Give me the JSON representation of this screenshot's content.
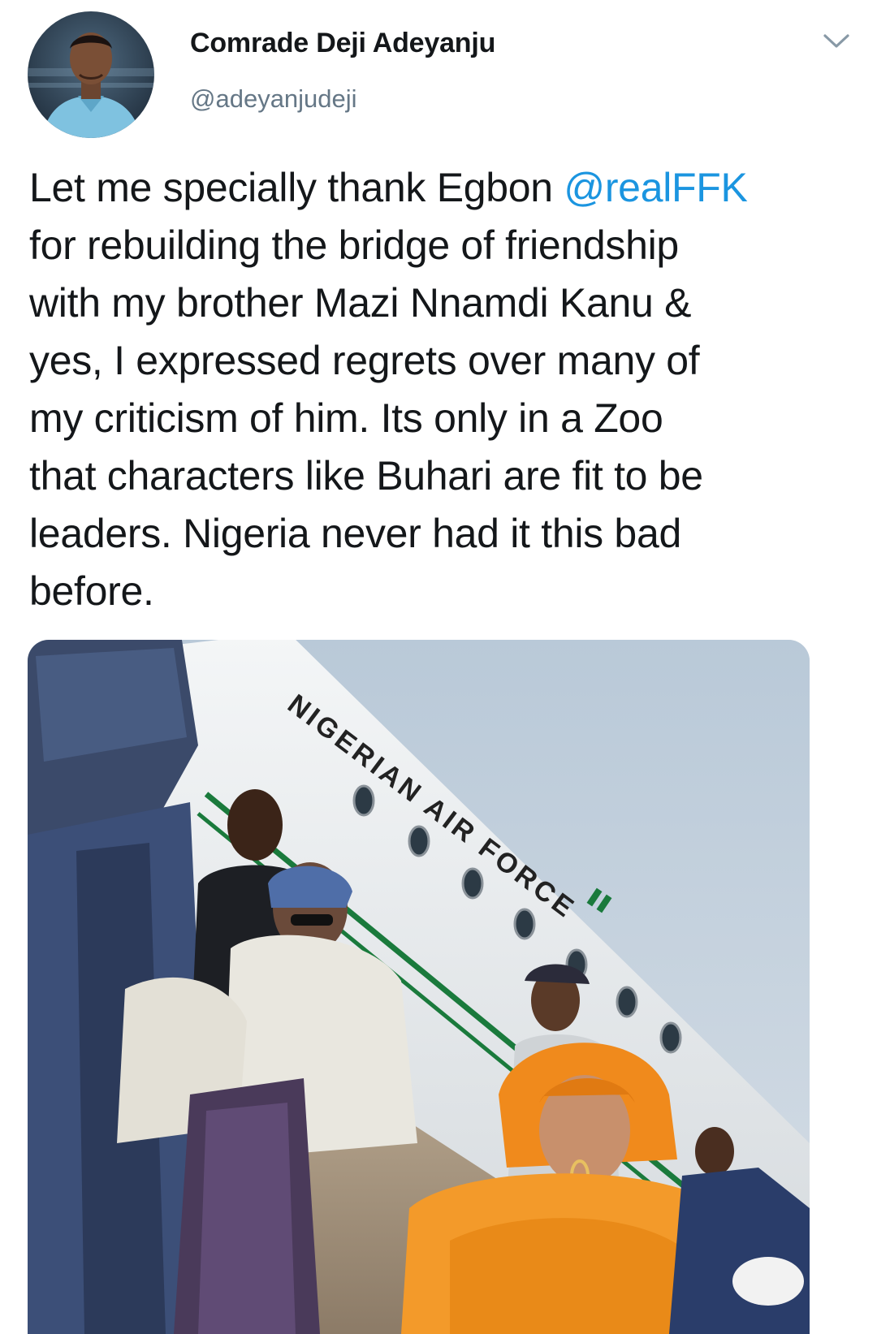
{
  "author": {
    "display_name": "Comrade Deji Adeyanju",
    "handle": "@adeyanjudeji"
  },
  "tweet": {
    "lines": [
      {
        "before": "Let me specially thank Egbon ",
        "mention": "@realFFK"
      },
      {
        "text": "for rebuilding the bridge of friendship"
      },
      {
        "text": "with my brother Mazi Nnamdi Kanu &"
      },
      {
        "text": "yes, I expressed regrets over many of"
      },
      {
        "text": "my criticism of him. Its only in a Zoo"
      },
      {
        "text": "that characters like Buhari are fit to be"
      },
      {
        "text": "leaders. Nigeria never had it this bad"
      },
      {
        "text": "before."
      }
    ]
  },
  "media": {
    "aircraft_lettering": "NIGERIAN AIR FORCE"
  },
  "icons": {
    "menu": "chevron-down-icon",
    "avatar": "profile-photo"
  },
  "colors": {
    "text": "#14171a",
    "secondary": "#657786",
    "link": "#1b95e0",
    "background": "#ffffff"
  }
}
